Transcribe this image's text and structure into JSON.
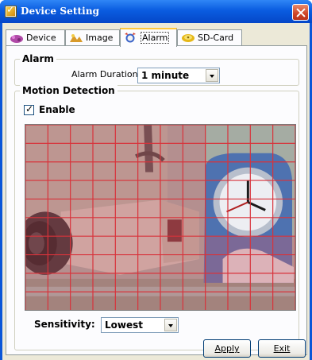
{
  "window": {
    "title": "Device Setting"
  },
  "tabs": [
    {
      "label": "Device",
      "icon": "device-icon"
    },
    {
      "label": "Image",
      "icon": "image-icon"
    },
    {
      "label": "Alarm",
      "icon": "alarm-icon"
    },
    {
      "label": "SD-Card",
      "icon": "sd-card-icon"
    }
  ],
  "active_tab": "Alarm",
  "alarm": {
    "group_title": "Alarm",
    "duration_label": "Alarm Duration:",
    "duration_value": "1 minute"
  },
  "motion": {
    "group_title": "Motion Detection",
    "enable_label": "Enable",
    "enable_checked": true,
    "grid_columns": 12,
    "grid_rows": 10,
    "selected_cells": "top-left 9 columns × 5 rows and lower rows partially",
    "sensitivity_label": "Sensitivity:",
    "sensitivity_value": "Lowest"
  },
  "buttons": {
    "apply": "Apply",
    "exit": "Exit"
  },
  "colors": {
    "grid_line": "#d8333b",
    "selection_tint": "#d05a6a",
    "title_bar": "#0a5ce0"
  }
}
